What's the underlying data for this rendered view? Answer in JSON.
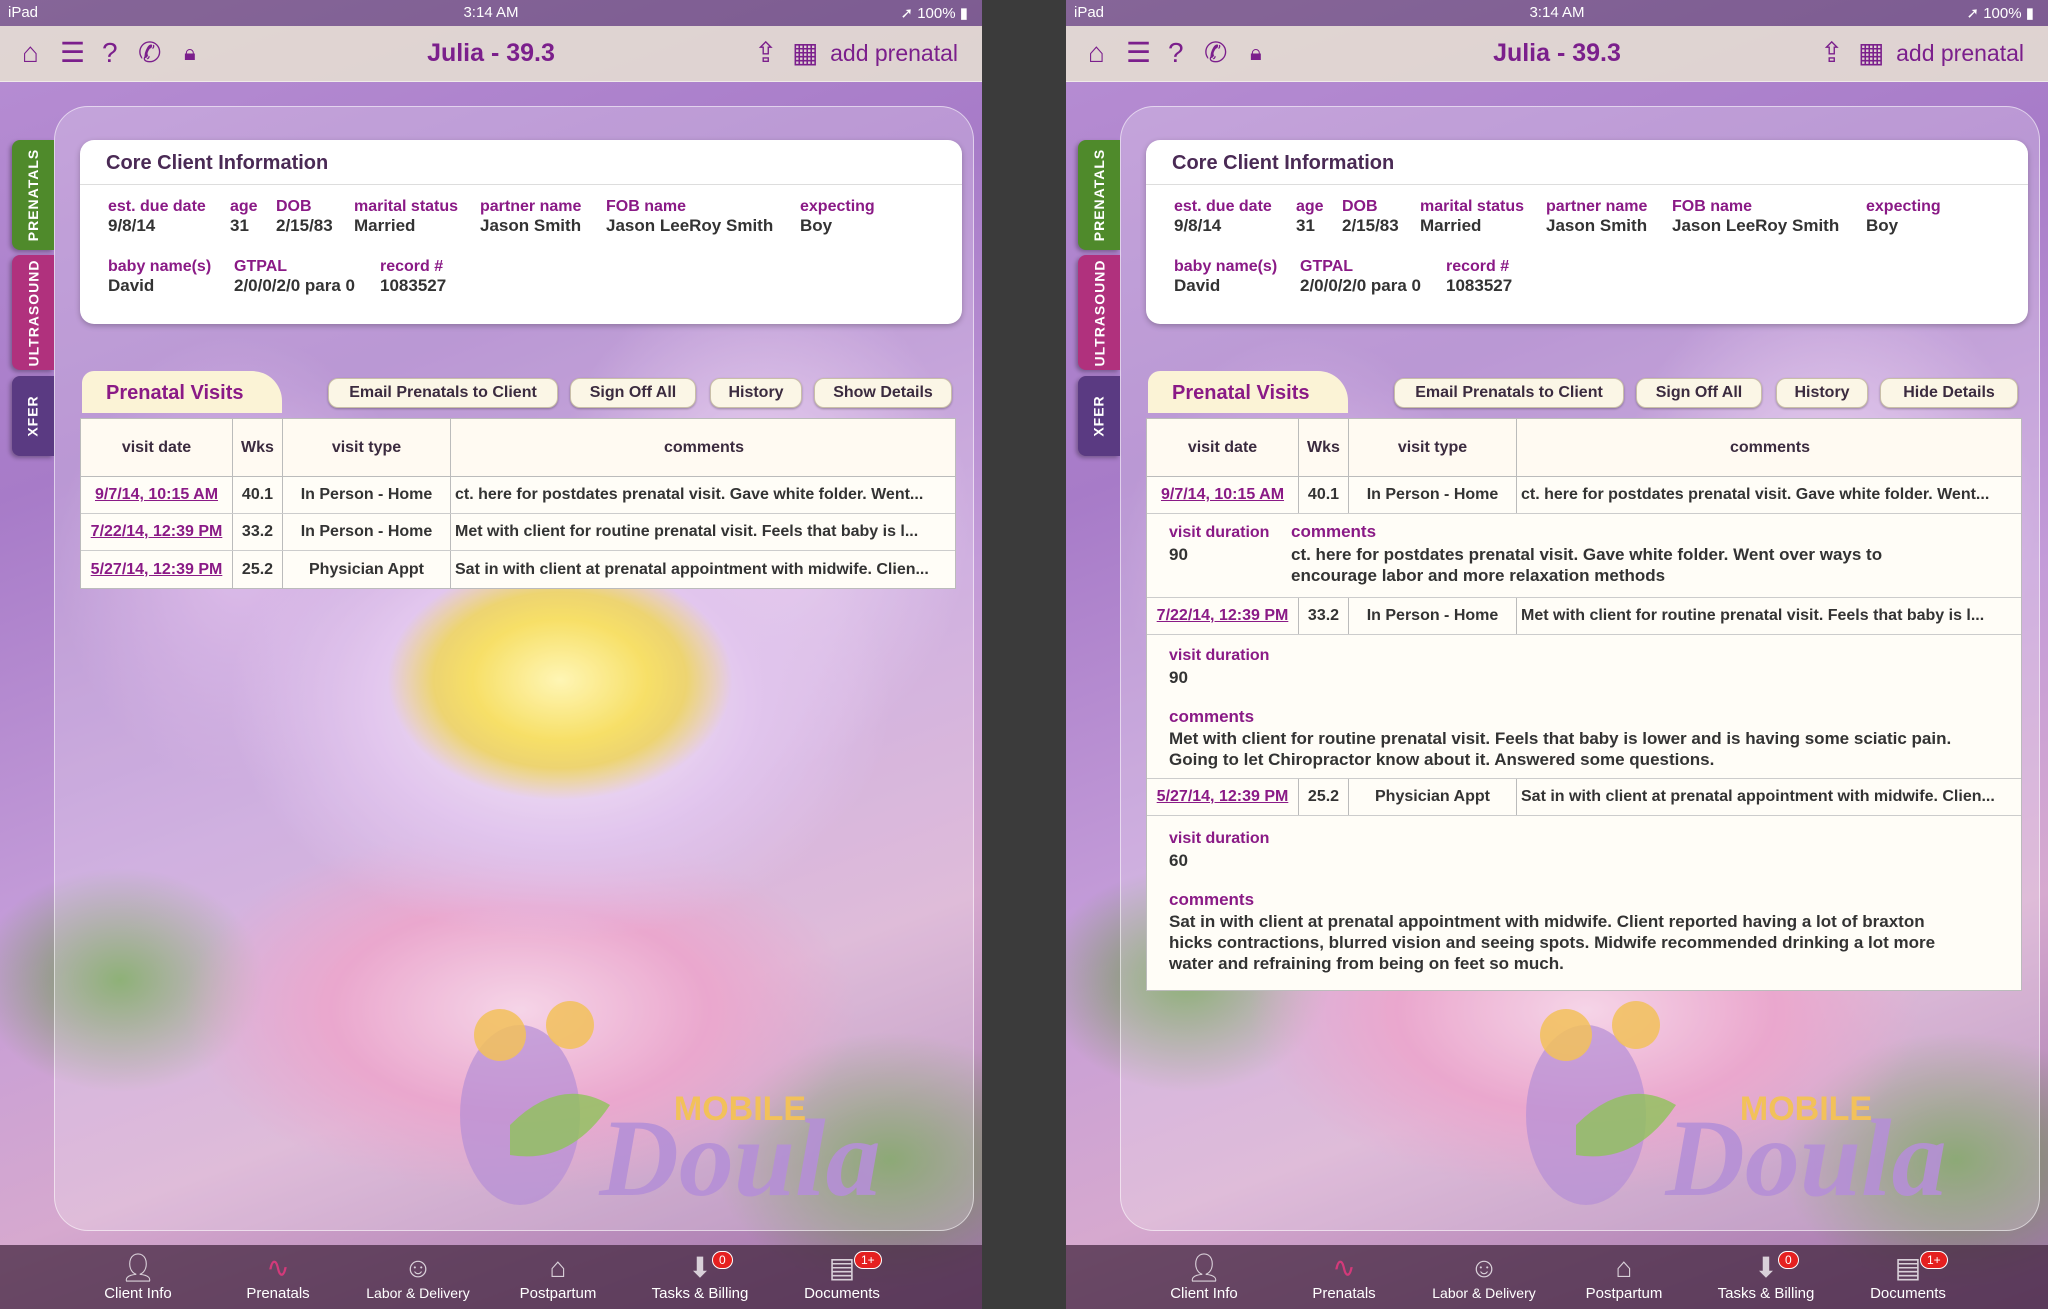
{
  "status": {
    "device": "iPad",
    "time": "3:14 AM",
    "battery": "100%"
  },
  "header": {
    "title": "Julia - 39.3",
    "add_label": "add prenatal"
  },
  "side_tabs": [
    "PRENATALS",
    "ULTRASOUND",
    "XFER"
  ],
  "core": {
    "title": "Core Client Information",
    "fields": [
      {
        "key": "est. due date",
        "value": "9/8/14"
      },
      {
        "key": "age",
        "value": "31"
      },
      {
        "key": "DOB",
        "value": "2/15/83"
      },
      {
        "key": "marital status",
        "value": "Married"
      },
      {
        "key": "partner name",
        "value": "Jason Smith"
      },
      {
        "key": "FOB name",
        "value": "Jason LeeRoy Smith"
      },
      {
        "key": "expecting",
        "value": "Boy"
      },
      {
        "key": "baby name(s)",
        "value": "David"
      },
      {
        "key": "GTPAL",
        "value": "2/0/0/2/0 para 0"
      },
      {
        "key": "record #",
        "value": "1083527"
      }
    ]
  },
  "prenatal": {
    "tab_label": "Prenatal Visits",
    "email_btn": "Email Prenatals to Client",
    "signoff_btn": "Sign Off All",
    "history_btn": "History",
    "show_details_btn": "Show Details",
    "hide_details_btn": "Hide Details",
    "columns": [
      "visit date",
      "Wks",
      "visit type",
      "comments"
    ],
    "rows": [
      {
        "date": "9/7/14, 10:15 AM",
        "wks": "40.1",
        "type": "In Person - Home",
        "comment_short": "ct. here for postdates prenatal visit.  Gave white folder.  Went...",
        "comment_row2": "ct. here for postdates prenatal visit.  Gave white folder.  Went...",
        "duration": "90",
        "comment_full1": "ct. here for postdates prenatal visit.  Gave white folder.  Went over ways to",
        "comment_full2": "encourage labor and more relaxation methods"
      },
      {
        "date": "7/22/14, 12:39 PM",
        "wks": "33.2",
        "type": "In Person - Home",
        "comment_short": "Met with client for routine prenatal visit.  Feels that baby is l...",
        "comment_row2": "Met with client for routine prenatal visit.  Feels that baby is l...",
        "duration": "90",
        "comment_full1": "Met with client for routine prenatal visit.  Feels that baby is lower and is having some sciatic pain.",
        "comment_full2": "Going to let Chiropractor know about it.  Answered some questions."
      },
      {
        "date": "5/27/14, 12:39 PM",
        "wks": "25.2",
        "type": "Physician Appt",
        "comment_short": "Sat in with client at prenatal appointment with midwife. Clien...",
        "comment_row2": "Sat in with client at prenatal appointment with midwife. Clien...",
        "duration": "60",
        "comment_full1": "Sat in with client at prenatal appointment with midwife. Client reported having a lot of braxton",
        "comment_full2": "hicks contractions, blurred vision and seeing spots. Midwife recommended drinking a lot more",
        "comment_full3": "water and refraining from being on feet so much."
      }
    ],
    "duration_label": "visit duration",
    "comments_label": "comments"
  },
  "logo": {
    "top": "MOBILE",
    "main": "Doula"
  },
  "bottom_nav": [
    {
      "label": "Client Info"
    },
    {
      "label": "Prenatals"
    },
    {
      "label": "Labor & Delivery"
    },
    {
      "label": "Postpartum"
    },
    {
      "label": "Tasks & Billing",
      "badge": "0"
    },
    {
      "label": "Documents",
      "badge": "1+"
    }
  ],
  "colors": {
    "accent": "#7b1f8c",
    "label": "#8a1a86",
    "badge": "#e52020"
  }
}
